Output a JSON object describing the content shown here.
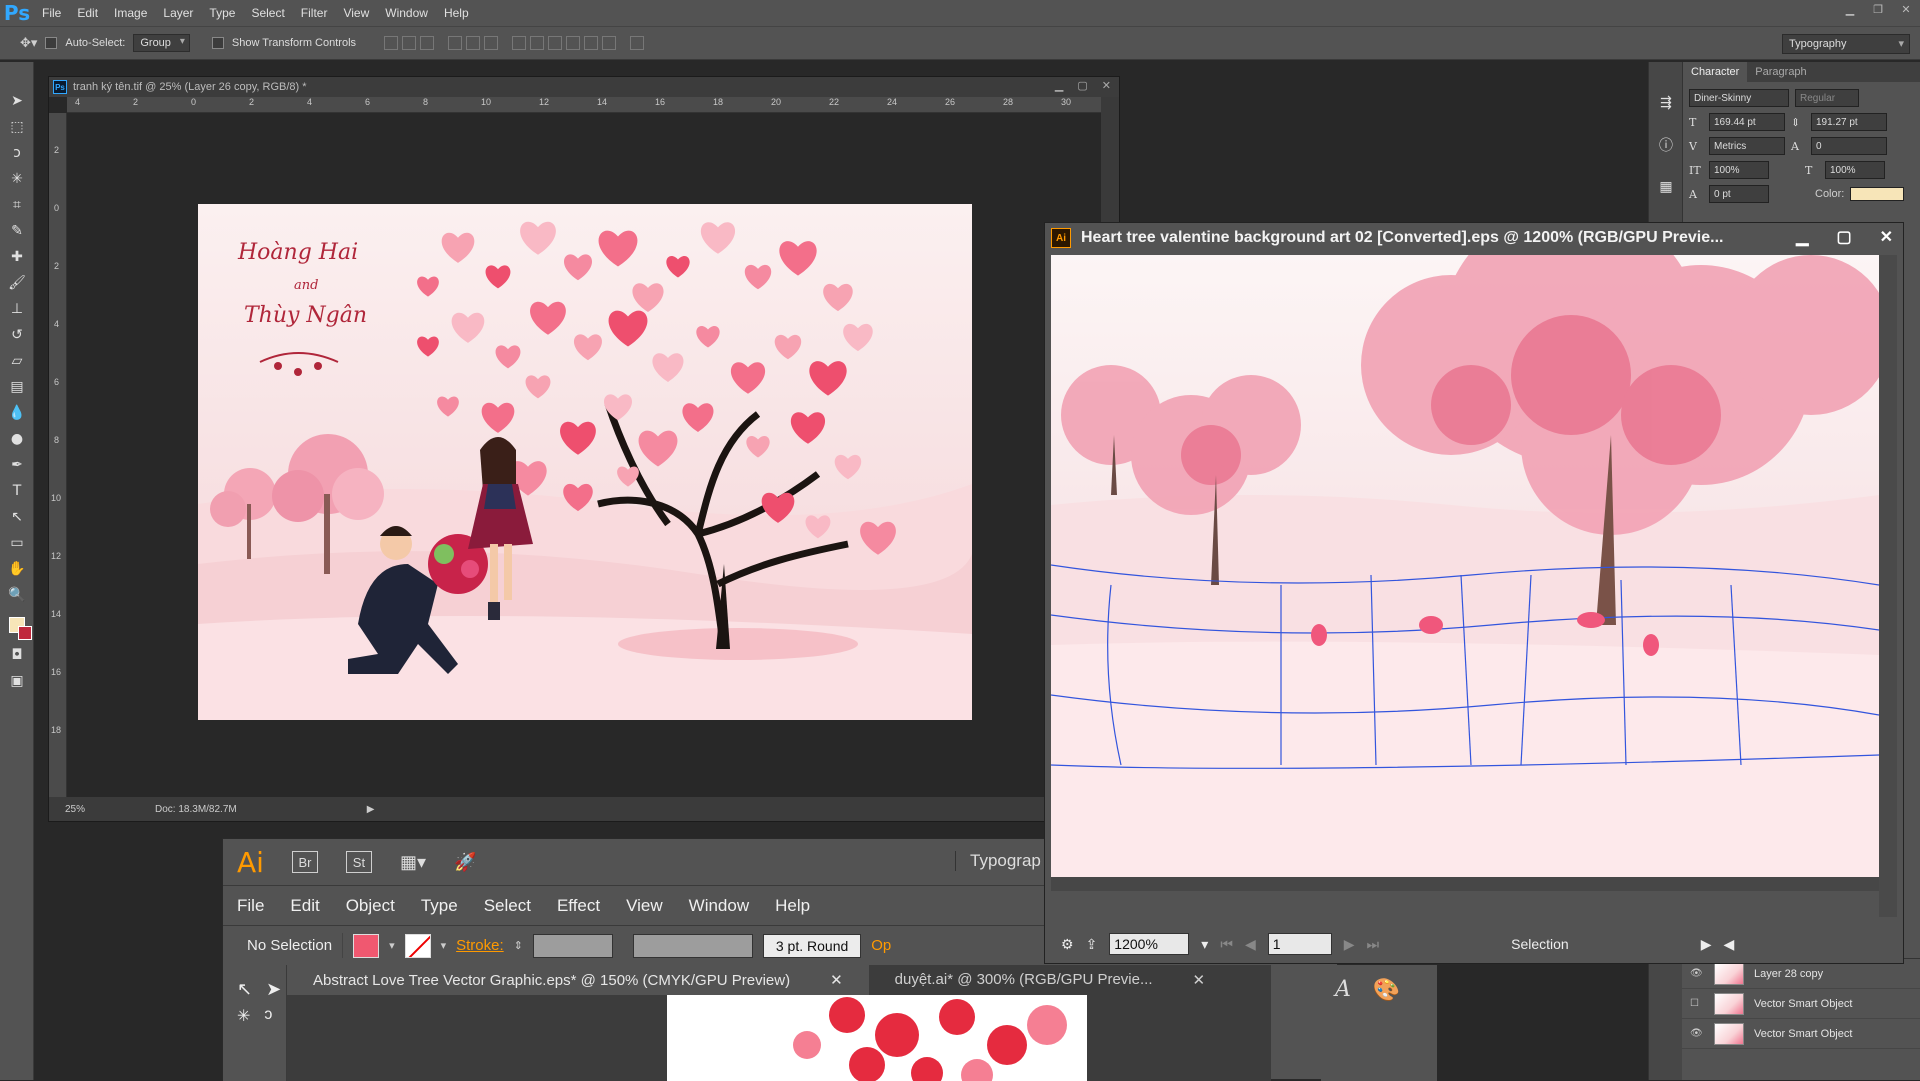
{
  "ps": {
    "logo": "Ps",
    "menu": [
      "File",
      "Edit",
      "Image",
      "Layer",
      "Type",
      "Select",
      "Filter",
      "View",
      "Window",
      "Help"
    ],
    "options": {
      "auto_select_label": "Auto-Select:",
      "auto_select_value": "Group",
      "transform_label": "Show Transform Controls"
    },
    "workspace": "Typography",
    "doc": {
      "title": "tranh ký tên.tif @ 25% (Layer 26 copy, RGB/8) *",
      "zoom": "25%",
      "doc_size": "Doc: 18.3M/82.7M",
      "ruler_top": [
        "4",
        "2",
        "0",
        "2",
        "4",
        "6",
        "8",
        "10",
        "12",
        "14",
        "16",
        "18",
        "20",
        "22",
        "24",
        "26",
        "28",
        "30"
      ],
      "ruler_left": [
        "2",
        "0",
        "2",
        "4",
        "6",
        "8",
        "10",
        "12",
        "14",
        "16",
        "18"
      ]
    },
    "artwork": {
      "name_line1": "Hoàng Hai",
      "name_and": "and",
      "name_line2": "Thùy Ngân"
    },
    "character": {
      "tab_character": "Character",
      "tab_paragraph": "Paragraph",
      "font_family": "Diner-Skinny",
      "font_style": "Regular",
      "font_size": "169.44 pt",
      "leading": "191.27 pt",
      "kerning": "Metrics",
      "tracking": "0",
      "vscale": "100%",
      "hscale": "100%",
      "baseline": "0 pt",
      "color_label": "Color:",
      "color": "#f7e5b8"
    },
    "layers": [
      {
        "name": "Layer 28 copy"
      },
      {
        "name": "Vector Smart Object"
      },
      {
        "name": "Vector Smart Object"
      }
    ]
  },
  "ai": {
    "logo": "Ai",
    "bridge": "Br",
    "stock": "St",
    "workspace": "Typograp",
    "menu": [
      "File",
      "Edit",
      "Object",
      "Type",
      "Select",
      "Effect",
      "View",
      "Window",
      "Help"
    ],
    "control": {
      "selection": "No Selection",
      "stroke_label": "Stroke:",
      "brush": "3 pt. Round",
      "opacity_stub": "Op"
    },
    "tabs": [
      {
        "label": "Abstract Love Tree Vector Graphic.eps* @ 150% (CMYK/GPU Preview)"
      },
      {
        "label": "duyệt.ai* @ 300% (RGB/GPU Previe..."
      }
    ],
    "float_doc": {
      "title": "Heart tree valentine background art 02 [Converted].eps @ 1200% (RGB/GPU Previe...",
      "zoom": "1200%",
      "page": "1",
      "tool_status": "Selection"
    }
  },
  "colors": {
    "ps_accent": "#31a8ff",
    "ai_accent": "#ff9a00",
    "fill_swatch": "#f05870"
  }
}
